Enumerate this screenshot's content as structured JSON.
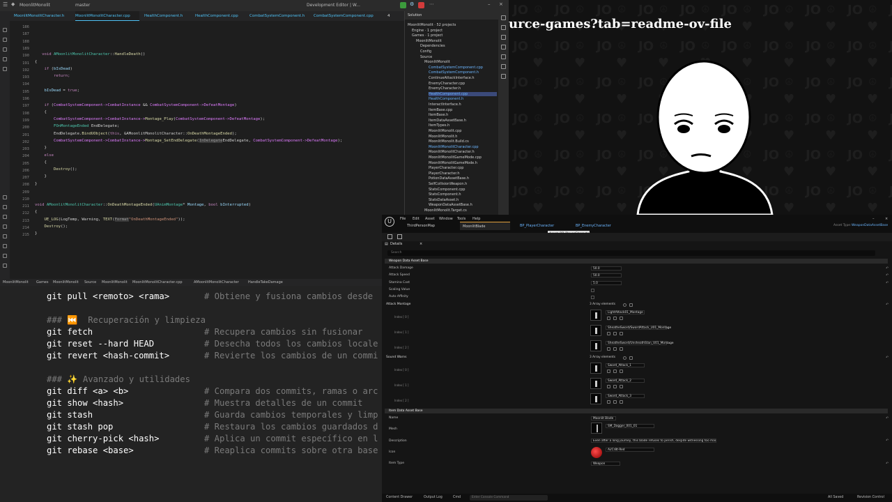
{
  "ide": {
    "menu": {
      "project": "MoonlitMonolit",
      "branch": "master",
      "config": "Development Editor | W..."
    },
    "tabs": [
      {
        "label": "MoonlitMonolitCharacter.h"
      },
      {
        "label": "MoonlitMonolitCharacter.cpp"
      },
      {
        "label": "HealthComponent.h"
      },
      {
        "label": "HealthComponent.cpp"
      },
      {
        "label": "CombatSystemComponent.h"
      },
      {
        "label": "CombatSystemComponent.cpp"
      }
    ],
    "active_tab_index": 1,
    "warning_count": "4",
    "line_numbers": [
      "186",
      "187",
      "188",
      "189",
      "190",
      "191",
      "192",
      "193",
      "194",
      "195",
      "196",
      "197",
      "198",
      "199",
      "200",
      "201",
      "202",
      "203",
      "204",
      "205",
      "206",
      "207",
      "208",
      "209",
      "210",
      "211",
      "212",
      "213",
      "214",
      "215"
    ],
    "code": {
      "l190a": "void ",
      "l190b": "AMoonlitMonolitCharacter",
      "l190c": "::",
      "l190d": "HandleDeath",
      "l190e": "()",
      "l191": "{",
      "l192a": "if",
      "l192b": " (",
      "l192c": "bIsDead",
      "l192d": ")",
      "l193": "return;",
      "l195a": "bIsDead",
      "l195b": " = ",
      "l195c": "true",
      "l195d": ";",
      "l197a": "if",
      "l197b": " (",
      "l197c": "CombatSystemComponent->CombatInstance",
      "l197d": " && ",
      "l197e": "CombatSystemComponent->DefeatMontage",
      "l197f": ")",
      "l198": "{",
      "l199a": "CombatSystemComponent->CombatInstance->",
      "l199b": "Montage_Play",
      "l199c": "(",
      "l199d": "CombatSystemComponent->DefeatMontage",
      "l199e": ");",
      "l200a": "FOnMontageEnded",
      "l200b": " EndDelegate;",
      "l201a": "EndDelegate.",
      "l201b": "BindUObject",
      "l201c": "(",
      "l201d": "this",
      "l201e": ", &AMoonlitMonolitCharacter::",
      "l201f": "OnDeathMontageEnded",
      "l201g": ");",
      "l202a": "CombatSystemComponent->CombatInstance->",
      "l202b": "Montage_SetEndDelegate",
      "l202c": "(",
      "l202d": "InDelegate",
      "l202e": "EndDelegate, ",
      "l202f": "CombatSystemComponent->DefeatMontage",
      "l202g": ");",
      "l203": "}",
      "l204": "else",
      "l205": "{",
      "l206a": "Destroy",
      "l206b": "();",
      "l207": "}",
      "l208": "}",
      "l211a": "void ",
      "l211b": "AMoonlitMonolitCharacter",
      "l211c": "::",
      "l211d": "OnDeathMontageEnded",
      "l211e": "(",
      "l211f": "UAnimMontage",
      "l211g": "* ",
      "l211h": "Montage",
      "l211i": ", ",
      "l211j": "bool",
      "l211k": " ",
      "l211l": "bInterrupted",
      "l211m": ")",
      "l212": "{",
      "l213a": "UE_LOG",
      "l213b": "(LogTemp, Warning, ",
      "l213c": "TEXT",
      "l213d": "(",
      "l213e": "Format",
      "l213f": "\"OnDeathMontageEnded\"",
      "l213g": "));",
      "l214a": "Destroy",
      "l214b": "();",
      "l215": "}"
    },
    "breadcrumb": [
      "MoonlitMonolit",
      "Games",
      "MoonlitMonolit",
      "Source",
      "MoonlitMonolit",
      "MoonlitMonolitCharacter.cpp",
      "AMoonlitMonolitCharacter",
      "HandleTakeDamage"
    ]
  },
  "solution": {
    "header": "Solution",
    "items": [
      {
        "label": "MoonlitMonolit · 52 projects",
        "indent": 0,
        "blue": false
      },
      {
        "label": "Engine · 1 project",
        "indent": 1,
        "blue": false
      },
      {
        "label": "Games · 1 project",
        "indent": 1,
        "blue": false
      },
      {
        "label": "MoonlitMonolit",
        "indent": 2,
        "blue": false
      },
      {
        "label": "Dependencies",
        "indent": 3,
        "blue": false
      },
      {
        "label": "Config",
        "indent": 3,
        "blue": false
      },
      {
        "label": "Source",
        "indent": 3,
        "blue": false
      },
      {
        "label": "MoonlitMonolit",
        "indent": 4,
        "blue": false
      },
      {
        "label": "CombatSystemComponent.cpp",
        "indent": 5,
        "blue": true
      },
      {
        "label": "CombatSystemComponent.h",
        "indent": 5,
        "blue": true
      },
      {
        "label": "ContinueAttackInterface.h",
        "indent": 5,
        "blue": false
      },
      {
        "label": "EnemyCharacter.cpp",
        "indent": 5,
        "blue": false
      },
      {
        "label": "EnemyCharacter.h",
        "indent": 5,
        "blue": false
      },
      {
        "label": "HealthComponent.cpp",
        "indent": 5,
        "blue": true,
        "selected": true
      },
      {
        "label": "HealthComponent.h",
        "indent": 5,
        "blue": true
      },
      {
        "label": "InteractInterface.h",
        "indent": 5,
        "blue": false
      },
      {
        "label": "ItemBase.cpp",
        "indent": 5,
        "blue": false
      },
      {
        "label": "ItemBase.h",
        "indent": 5,
        "blue": false
      },
      {
        "label": "ItemDataAssetBase.h",
        "indent": 5,
        "blue": false
      },
      {
        "label": "ItemTypes.h",
        "indent": 5,
        "blue": false
      },
      {
        "label": "MoonlitMonolit.cpp",
        "indent": 5,
        "blue": false
      },
      {
        "label": "MoonlitMonolit.h",
        "indent": 5,
        "blue": false
      },
      {
        "label": "MoonlitMonolit.Build.cs",
        "indent": 5,
        "blue": false
      },
      {
        "label": "MoonlitMonolitCharacter.cpp",
        "indent": 5,
        "blue": true
      },
      {
        "label": "MoonlitMonolitCharacter.h",
        "indent": 5,
        "blue": false
      },
      {
        "label": "MoonlitMonolitGameMode.cpp",
        "indent": 5,
        "blue": false
      },
      {
        "label": "MoonlitMonolitGameMode.h",
        "indent": 5,
        "blue": false
      },
      {
        "label": "PlayerCharacter.cpp",
        "indent": 5,
        "blue": false
      },
      {
        "label": "PlayerCharacter.h",
        "indent": 5,
        "blue": false
      },
      {
        "label": "PotionDataAssetBase.h",
        "indent": 5,
        "blue": false
      },
      {
        "label": "SelfCollisionWeapon.h",
        "indent": 5,
        "blue": false
      },
      {
        "label": "StatsComponent.cpp",
        "indent": 5,
        "blue": false
      },
      {
        "label": "StatsComponent.h",
        "indent": 5,
        "blue": false
      },
      {
        "label": "StatsDataAsset.h",
        "indent": 5,
        "blue": false
      },
      {
        "label": "WeaponDataAssetBase.h",
        "indent": 5,
        "blue": false
      },
      {
        "label": "MoonlitMonolit.Target.cs",
        "indent": 4,
        "blue": false
      }
    ]
  },
  "webcam": {
    "overlay_text": "urce-games?tab=readme-ov-file"
  },
  "git": {
    "lines": [
      {
        "cmd": "git pull <remoto> <rama>",
        "comment": "# Obtiene y fusiona cambios desde"
      },
      {
        "heading": "### ⏮️  Recuperación y limpieza"
      },
      {
        "cmd": "git fetch",
        "comment": "# Recupera cambios sin fusionar"
      },
      {
        "cmd": "git reset --hard HEAD",
        "comment": "# Desecha todos los cambios locale"
      },
      {
        "cmd": "git revert <hash-commit>",
        "comment": "# Revierte los cambios de un commi"
      },
      {
        "heading": "### ✨ Avanzado y utilidades"
      },
      {
        "cmd": "git diff <a> <b>",
        "comment": "# Compara dos commits, ramas o arc"
      },
      {
        "cmd": "git show <hash>",
        "comment": "# Muestra detalles de un commit"
      },
      {
        "cmd": "git stash",
        "comment": "# Guarda cambios temporales y limp"
      },
      {
        "cmd": "git stash pop",
        "comment": "# Restaura los cambios guardados d"
      },
      {
        "cmd": "git cherry-pick <hash>",
        "comment": "# Aplica un commit específico en l"
      },
      {
        "cmd": "git rebase <base>",
        "comment": "# Reaplica commits sobre otra base"
      }
    ]
  },
  "unreal": {
    "menu": [
      "File",
      "Edit",
      "Asset",
      "Window",
      "Tools",
      "Help"
    ],
    "tabs": [
      "ThirdPersonMap",
      "MoonlitBlade",
      "BP_PlayerCharacter",
      "BP_EnemyCharacter"
    ],
    "asset_type_label": "Asset Type:",
    "asset_type_value": "WeaponDataAssetBase",
    "tooltip": "Asset: BP_PlayerCharacter",
    "details_tab": "Details",
    "search_placeholder": "Search",
    "section_weapon": "Weapon Data Asset Base",
    "attack_damage_label": "Attack Damage",
    "attack_damage": "50.0",
    "attack_speed_label": "Attack Speed",
    "attack_speed": "50.0",
    "stamina_cost_label": "Stamina Cost",
    "stamina_cost": "5.0",
    "scaling_value_label": "Scaling Value",
    "auto_affinity_label": "Auto Affinity",
    "attack_montage_label": "Attack Montage",
    "array_count": "3 Array elements",
    "montages": [
      {
        "index": "Index [ 0 ]",
        "value": "LightAttack01_Montage"
      },
      {
        "index": "Index [ 1 ]",
        "value": "SheatheSword/SwordAttack_U01_Montage"
      },
      {
        "index": "Index [ 2 ]",
        "value": "SheatheSword/UnsheathStan_U01_Montage"
      }
    ],
    "sound_warns_label": "Sound Warns",
    "sounds": [
      {
        "index": "Index [ 0 ]",
        "value": "Sword_Attack_1"
      },
      {
        "index": "Index [ 1 ]",
        "value": "Sword_Attack_2"
      },
      {
        "index": "Index [ 2 ]",
        "value": "Sword_Attack_3"
      }
    ],
    "section_item": "Item Data Asset Base",
    "name_label": "Name",
    "name_value": "Moonlit Blade",
    "mesh_label": "Mesh",
    "mesh_value": "SM_Dagger_001_01",
    "description_label": "Description",
    "description_value": "Even after a long journey, this blade refuses to perish, despite witnessing too many moons.",
    "icon_label": "Icon",
    "icon_value": "Ai/Cr8t-Red",
    "item_type_label": "Item Type",
    "item_type_value": "Weapon",
    "footer": {
      "content_drawer": "Content Drawer",
      "output_log": "Output Log",
      "cmd": "Cmd",
      "cmd_placeholder": "Enter Console Command",
      "all_saved": "All Saved",
      "revision_control": "Revision Control"
    }
  }
}
